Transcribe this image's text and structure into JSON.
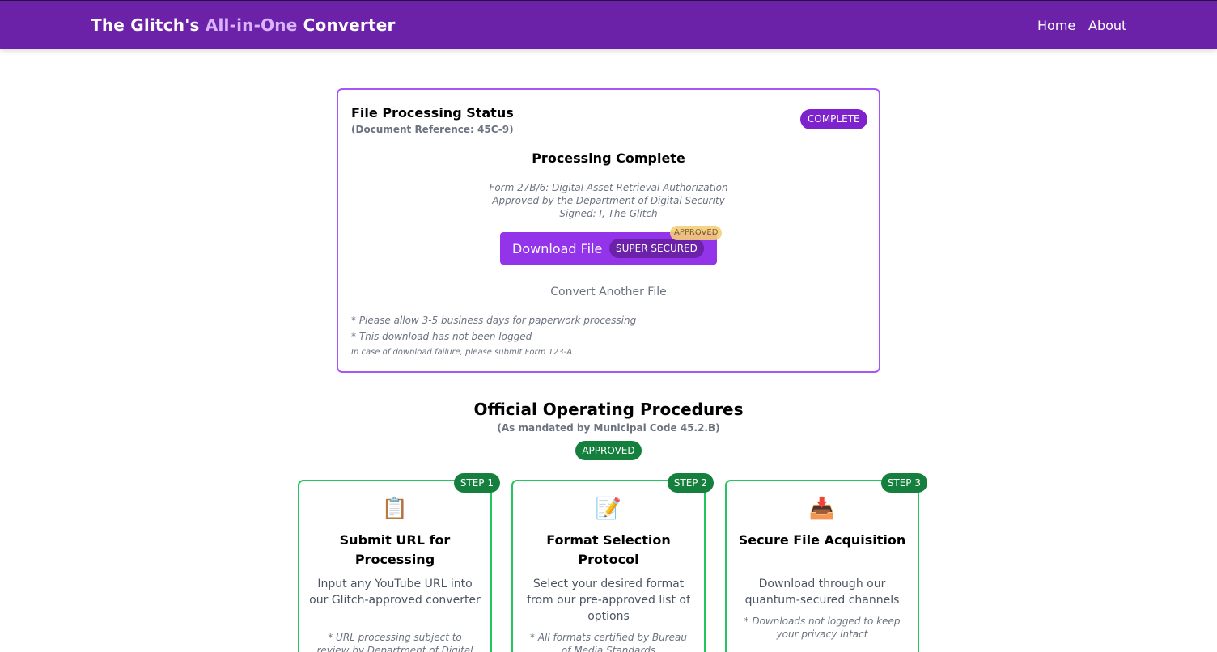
{
  "navbar": {
    "brand_prefix": "The Glitch's ",
    "brand_accent": "All-in-One",
    "brand_suffix": " Converter",
    "links": [
      "Home",
      "About"
    ],
    "colors": {
      "background": "#6b21a8",
      "accent": "#d8b4fe"
    }
  },
  "status_card": {
    "title": "File Processing Status",
    "reference": "(Document Reference: 45C-9)",
    "badge": "COMPLETE",
    "processing_title": "Processing Complete",
    "form_lines": [
      "Form 27B/6: Digital Asset Retrieval Authorization",
      "Approved by the Department of Digital Security",
      "Signed: I, The Glitch"
    ],
    "download_label": "Download File",
    "secured_label": "SUPER SECURED",
    "approved_stamp": "APPROVED",
    "convert_another": "Convert Another File",
    "notes": [
      "* Please allow 3-5 business days for paperwork processing",
      "* This download has not been logged",
      "In case of download failure, please submit Form 123-A"
    ]
  },
  "procedures": {
    "title": "Official Operating Procedures",
    "subtitle": "(As mandated by Municipal Code 45.2.B)",
    "badge": "APPROVED",
    "steps": [
      {
        "badge": "STEP 1",
        "icon": "📋",
        "icon_name": "clipboard-icon",
        "title": "Submit URL for Processing",
        "description": "Input any YouTube URL into our Glitch-approved converter",
        "note": "* URL processing subject to review by Department of Digital"
      },
      {
        "badge": "STEP 2",
        "icon": "📝",
        "icon_name": "memo-icon",
        "title": "Format Selection Protocol",
        "description": "Select your desired format from our pre-approved list of options",
        "note": "* All formats certified by Bureau of Media Standards"
      },
      {
        "badge": "STEP 3",
        "icon": "📥",
        "icon_name": "inbox-tray-icon",
        "title": "Secure File Acquisition",
        "description": "Download through our quantum-secured channels",
        "note": "* Downloads not logged to keep your privacy intact"
      }
    ]
  }
}
